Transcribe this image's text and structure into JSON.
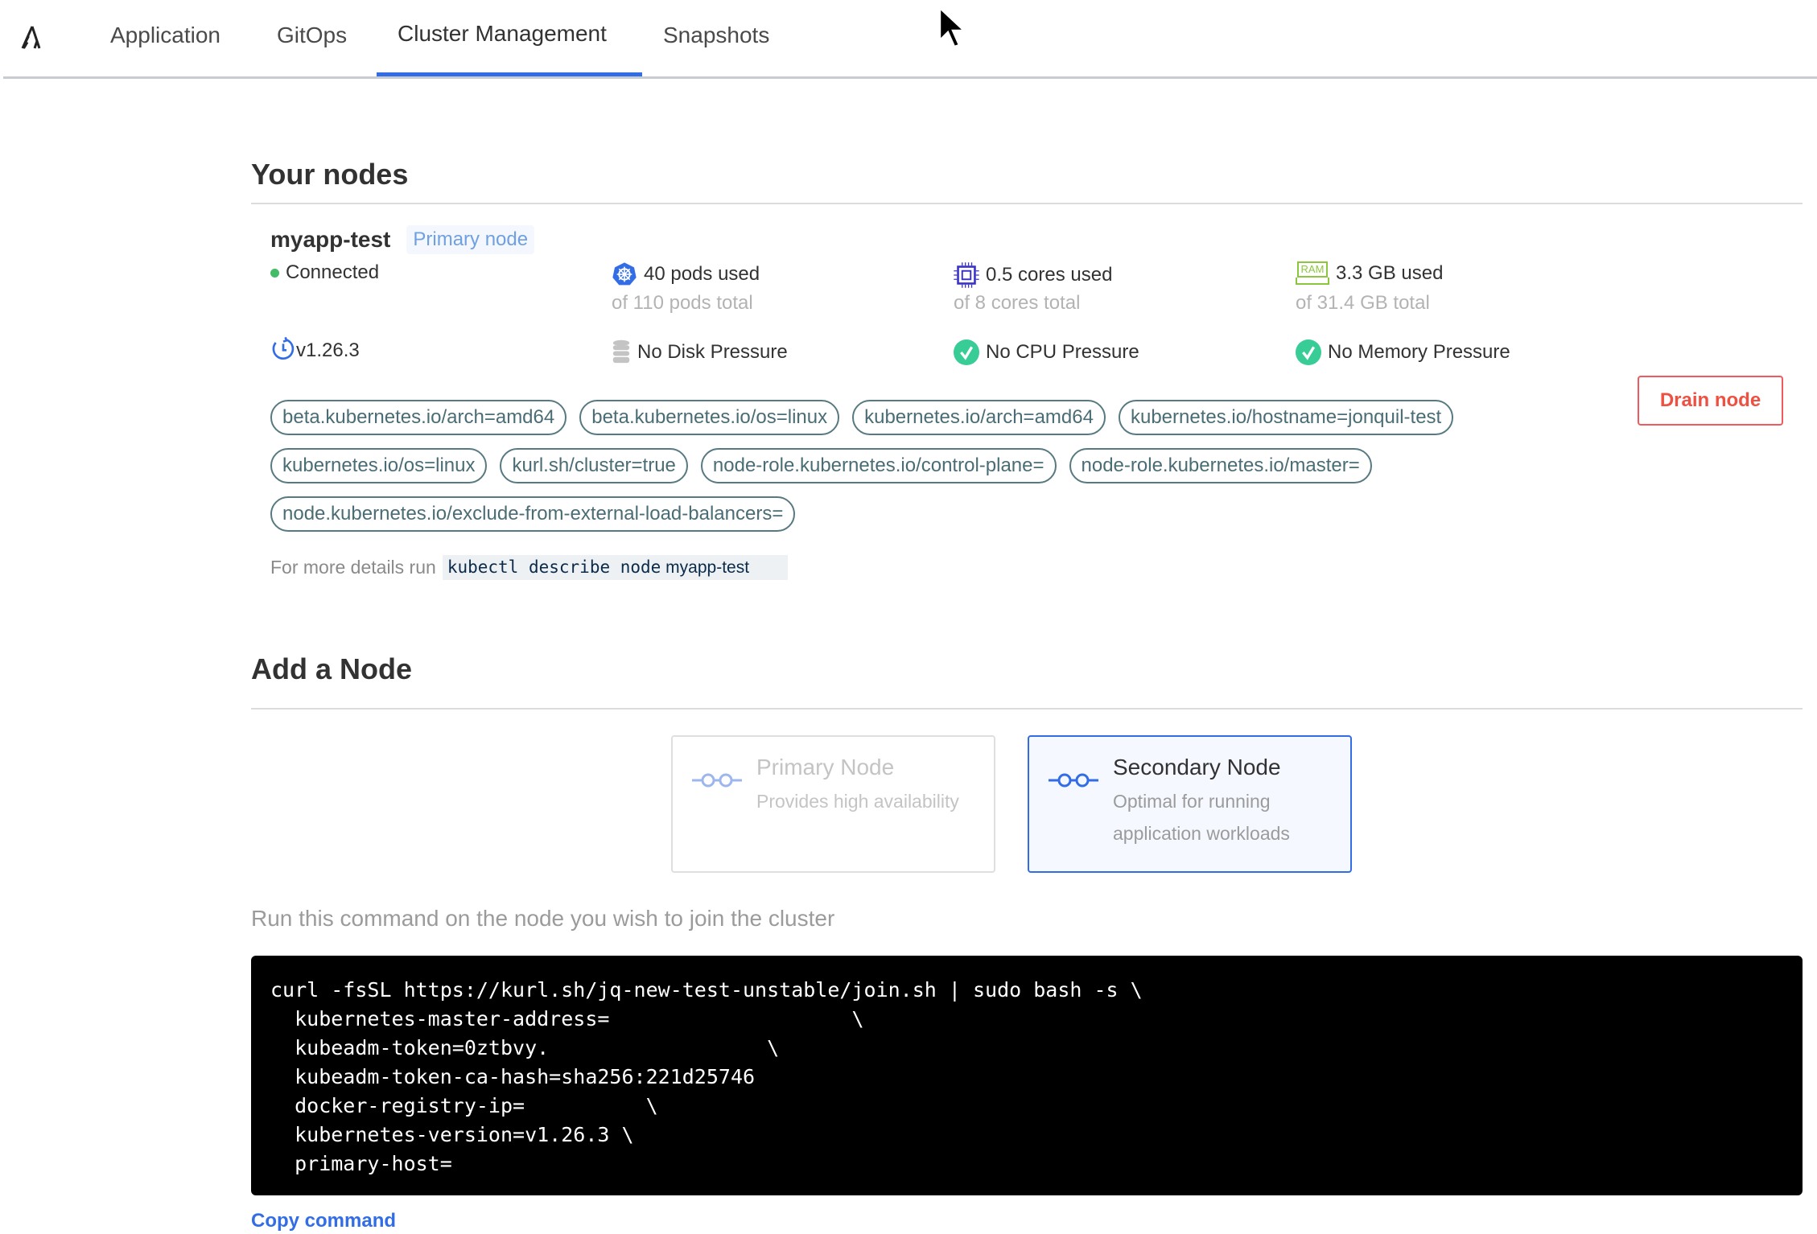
{
  "nav": {
    "tabs": [
      {
        "label": "Application"
      },
      {
        "label": "GitOps"
      },
      {
        "label": "Cluster Management",
        "active": true
      },
      {
        "label": "Snapshots"
      }
    ]
  },
  "nodes": {
    "title": "Your nodes",
    "node": {
      "name": "myapp-test",
      "badge": "Primary node",
      "status": "Connected",
      "version": "v1.26.3",
      "pods": {
        "used": "40 pods used",
        "total": "of 110 pods total"
      },
      "cpu": {
        "used": "0.5 cores used",
        "total": "of 8 cores total"
      },
      "memory": {
        "used": "3.3 GB used",
        "total": "of 31.4 GB total",
        "icon_label": "RAM"
      },
      "conditions": [
        "No Disk Pressure",
        "No CPU Pressure",
        "No Memory Pressure"
      ],
      "labels": [
        "beta.kubernetes.io/arch=amd64",
        "beta.kubernetes.io/os=linux",
        "kubernetes.io/arch=amd64",
        "kubernetes.io/hostname=jonquil-test",
        "kubernetes.io/os=linux",
        "kurl.sh/cluster=true",
        "node-role.kubernetes.io/control-plane=",
        "node-role.kubernetes.io/master=",
        "node.kubernetes.io/exclude-from-external-load-balancers="
      ],
      "details_prefix": "For more details run",
      "details_cmd": "kubectl describe node",
      "details_node": "myapp-test",
      "drain_label": "Drain node"
    }
  },
  "add": {
    "title": "Add a Node",
    "primary": {
      "title": "Primary Node",
      "desc": "Provides high availability"
    },
    "secondary": {
      "title": "Secondary Node",
      "desc": "Optimal for running application workloads"
    },
    "instructions": "Run this command on the node you wish to join the cluster",
    "command": "curl -fsSL https://kurl.sh/jq-new-test-unstable/join.sh | sudo bash -s \\\n  kubernetes-master-address=                    \\\n  kubeadm-token=0ztbvy.                  \\\n  kubeadm-token-ca-hash=sha256:221d25746\n  docker-registry-ip=          \\\n  kubernetes-version=v1.26.3 \\\n  primary-host=",
    "copy_label": "Copy command"
  },
  "colors": {
    "accent": "#326de6",
    "danger": "#ee5042",
    "success": "#38cc97",
    "tag": "#577981"
  }
}
